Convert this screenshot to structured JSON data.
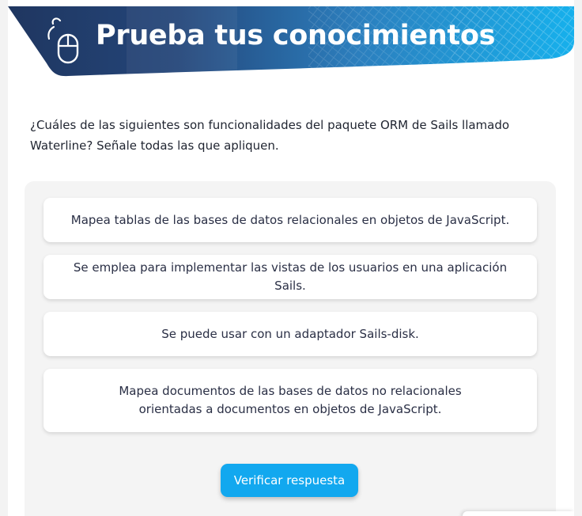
{
  "banner": {
    "title": "Prueba tus conocimientos",
    "icon": "mouse-click-icon",
    "colors": {
      "dark": "#203a66",
      "mid": "#2b78b3",
      "light": "#1aaee8"
    }
  },
  "question": {
    "text": "¿Cuáles de las siguientes son funcionalidades del paquete ORM de Sails llamado Waterline? Señale todas las que apliquen."
  },
  "options": [
    {
      "label": "Mapea tablas de las bases de datos relacionales en objetos de JavaScript."
    },
    {
      "label": "Se emplea para implementar las vistas de los usuarios en una aplicación Sails."
    },
    {
      "label": "Se puede usar con un adaptador Sails-disk."
    },
    {
      "label": "Mapea documentos de las bases de datos no relacionales orientadas a documentos en objetos de JavaScript."
    }
  ],
  "actions": {
    "verify_label": "Verificar respuesta",
    "accent": "#12a8ef"
  }
}
